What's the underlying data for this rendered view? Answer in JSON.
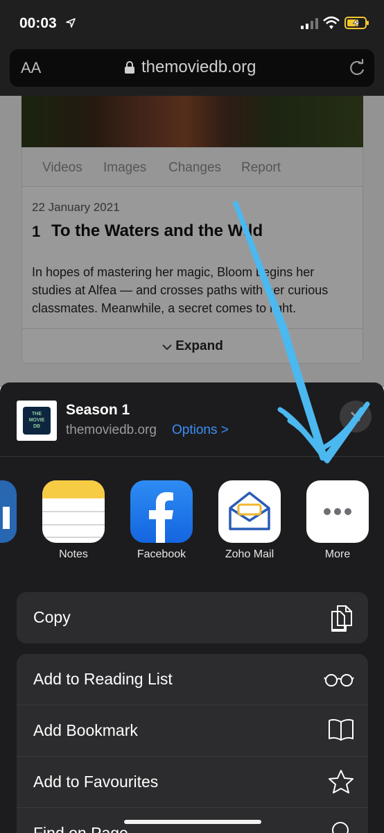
{
  "status_bar": {
    "time": "00:03"
  },
  "browser": {
    "text_size_label": "AA",
    "domain": "themoviedb.org"
  },
  "page": {
    "tabs": [
      "Videos",
      "Images",
      "Changes",
      "Report"
    ],
    "episode": {
      "date": "22 January 2021",
      "number": "1",
      "title": "To the Waters and the Wild",
      "description": "In hopes of mastering her magic, Bloom begins her studies at Alfea — and crosses paths with her curious classmates. Meanwhile, a secret comes to light.",
      "expand_label": "Expand"
    }
  },
  "share_sheet": {
    "logo_text": [
      "THE",
      "MOVIE",
      "DB"
    ],
    "title": "Season 1",
    "subtitle": "themoviedb.org",
    "options_label": "Options >",
    "apps": [
      {
        "label": "In",
        "icon": "linkedin-icon"
      },
      {
        "label": "Notes",
        "icon": "notes-icon"
      },
      {
        "label": "Facebook",
        "icon": "facebook-icon"
      },
      {
        "label": "Zoho Mail",
        "icon": "zoho-mail-icon"
      },
      {
        "label": "More",
        "icon": "more-icon"
      }
    ],
    "actions_group1": [
      {
        "label": "Copy",
        "icon": "copy-icon"
      }
    ],
    "actions_group2": [
      {
        "label": "Add to Reading List",
        "icon": "glasses-icon"
      },
      {
        "label": "Add Bookmark",
        "icon": "book-icon"
      },
      {
        "label": "Add to Favourites",
        "icon": "star-icon"
      },
      {
        "label": "Find on Page",
        "icon": "search-icon"
      }
    ]
  },
  "colors": {
    "accent": "#3e8ef7",
    "sheet_bg": "#1c1c1e",
    "row_bg": "#2c2c2e",
    "annotation": "#4cb8f0"
  }
}
